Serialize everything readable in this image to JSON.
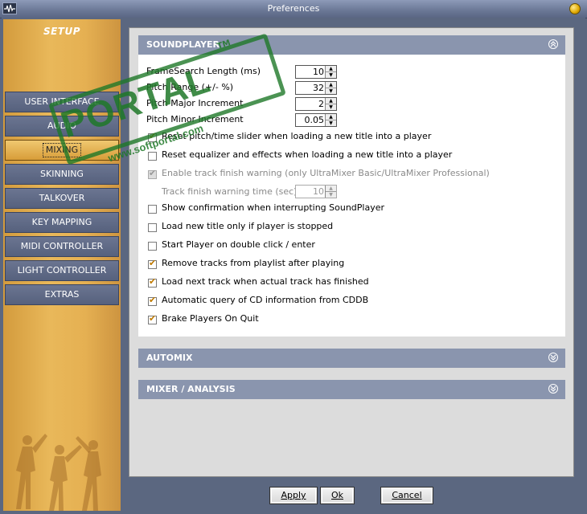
{
  "window": {
    "title": "Preferences"
  },
  "sidebar": {
    "heading": "SETUP",
    "items": [
      {
        "label": "USER INTERFACE",
        "active": false
      },
      {
        "label": "AUDIO",
        "active": false
      },
      {
        "label": "MIXING",
        "active": true
      },
      {
        "label": "SKINNING",
        "active": false
      },
      {
        "label": "TALKOVER",
        "active": false
      },
      {
        "label": "KEY MAPPING",
        "active": false
      },
      {
        "label": "MIDI CONTROLLER",
        "active": false
      },
      {
        "label": "LIGHT CONTROLLER",
        "active": false
      },
      {
        "label": "EXTRAS",
        "active": false
      }
    ]
  },
  "sections": {
    "soundplayer": "SOUNDPLAYER",
    "automix": "AUTOMIX",
    "mixer": "MIXER / ANALYSIS"
  },
  "spinners": [
    {
      "label": "FrameSearch Length (ms)",
      "value": "10"
    },
    {
      "label": "Pitch Range (+/- %)",
      "value": "32"
    },
    {
      "label": "Pitch Major Increment",
      "value": "2"
    },
    {
      "label": "Pitch Minor Increment",
      "value": "0.05"
    }
  ],
  "options": [
    {
      "label": "Reset pitch/time slider when loading a new title into a player",
      "checked": true,
      "enabled": true
    },
    {
      "label": "Reset equalizer and effects when loading a new title into a player",
      "checked": false,
      "enabled": true
    },
    {
      "label": "Enable track finish warning (only UltraMixer Basic/UltraMixer Professional)",
      "checked": true,
      "enabled": false
    },
    {
      "label": "Show confirmation when interrupting SoundPlayer",
      "checked": false,
      "enabled": true
    },
    {
      "label": "Load new title only if player is stopped",
      "checked": false,
      "enabled": true
    },
    {
      "label": "Start Player on double click / enter",
      "checked": false,
      "enabled": true
    },
    {
      "label": "Remove tracks from playlist after playing",
      "checked": true,
      "enabled": true
    },
    {
      "label": "Load next track when actual track has finished",
      "checked": true,
      "enabled": true
    },
    {
      "label": "Automatic query of CD information from CDDB",
      "checked": true,
      "enabled": true
    },
    {
      "label": "Brake Players On Quit",
      "checked": true,
      "enabled": true
    }
  ],
  "warning_time": {
    "label": "Track finish warning time (sec)",
    "value": "10"
  },
  "buttons": {
    "apply": "Apply",
    "ok": "Ok",
    "cancel": "Cancel"
  },
  "watermark": {
    "text": "PORTAL",
    "tm": "TM",
    "url": "www.softportal.com"
  },
  "colors": {
    "accent": "#e0a848",
    "section_header": "#8a95ae",
    "nav_button": "#5f6a86"
  }
}
